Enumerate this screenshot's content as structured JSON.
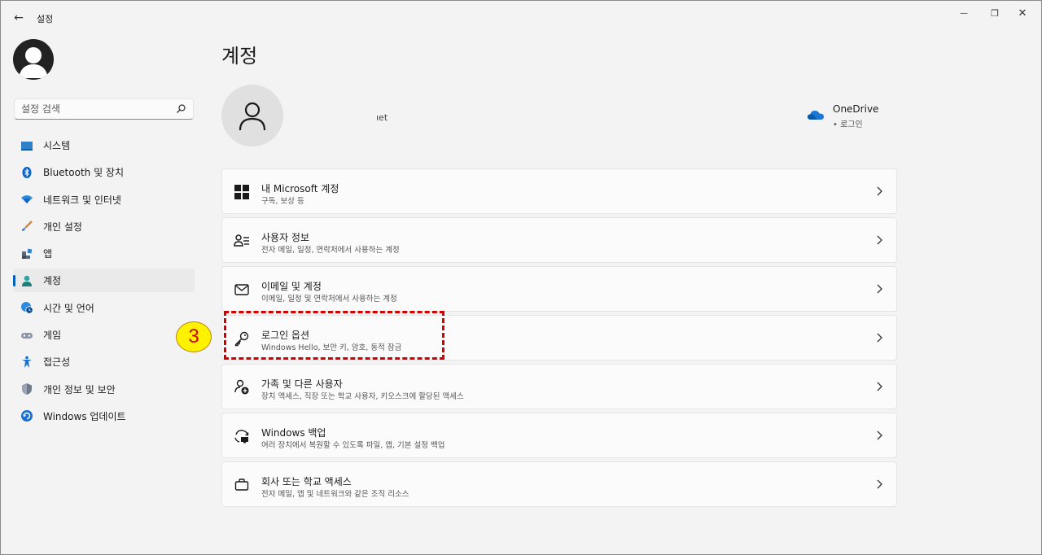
{
  "window": {
    "app_title": "설정",
    "back_glyph": "←",
    "minimize_glyph": "—",
    "maximize_glyph": "❐",
    "close_glyph": "✕"
  },
  "search": {
    "placeholder": "설정 검색"
  },
  "sidebar": {
    "items": [
      {
        "label": "시스템",
        "icon": "monitor-icon"
      },
      {
        "label": "Bluetooth 및 장치",
        "icon": "bluetooth-icon"
      },
      {
        "label": "네트워크 및 인터넷",
        "icon": "wifi-icon"
      },
      {
        "label": "개인 설정",
        "icon": "brush-icon"
      },
      {
        "label": "앱",
        "icon": "apps-icon"
      },
      {
        "label": "계정",
        "icon": "person-icon",
        "active": true
      },
      {
        "label": "시간 및 언어",
        "icon": "globe-clock-icon"
      },
      {
        "label": "게임",
        "icon": "gamepad-icon"
      },
      {
        "label": "접근성",
        "icon": "accessibility-icon"
      },
      {
        "label": "개인 정보 및 보안",
        "icon": "shield-icon"
      },
      {
        "label": "Windows 업데이트",
        "icon": "update-icon"
      }
    ]
  },
  "main": {
    "title": "계정",
    "account_email_fragment": "ıet",
    "onedrive": {
      "name": "OneDrive",
      "status": "• 로그인"
    },
    "cards": [
      {
        "title": "내 Microsoft 계정",
        "subtitle": "구독, 보상 등",
        "icon": "windows-logo-icon"
      },
      {
        "title": "사용자 정보",
        "subtitle": "전자 메일, 일정, 연락처에서 사용하는 계정",
        "icon": "user-info-icon"
      },
      {
        "title": "이메일 및 계정",
        "subtitle": "이메일, 일정 및 연락처에서 사용하는 계정",
        "icon": "mail-icon"
      },
      {
        "title": "로그인 옵션",
        "subtitle": "Windows Hello, 보안 키, 암호, 동적 잠금",
        "icon": "key-icon"
      },
      {
        "title": "가족 및 다른 사용자",
        "subtitle": "장치 액세스, 직장 또는 학교 사용자, 키오스크에 할당된 액세스",
        "icon": "family-add-icon"
      },
      {
        "title": "Windows 백업",
        "subtitle": "여러 장치에서 복원할 수 있도록 파일, 앱, 기본 설정 백업",
        "icon": "backup-icon"
      },
      {
        "title": "회사 또는 학교 액세스",
        "subtitle": "전자 메일, 앱 및 네트워크와 같은 조직 리소스",
        "icon": "briefcase-icon"
      }
    ]
  },
  "annotation": {
    "step_number": "3",
    "color": "#d40000",
    "badge_color": "#fff200"
  },
  "colors": {
    "accent": "#005fb8",
    "background": "#f3f3f3",
    "card": "#fbfbfb"
  }
}
